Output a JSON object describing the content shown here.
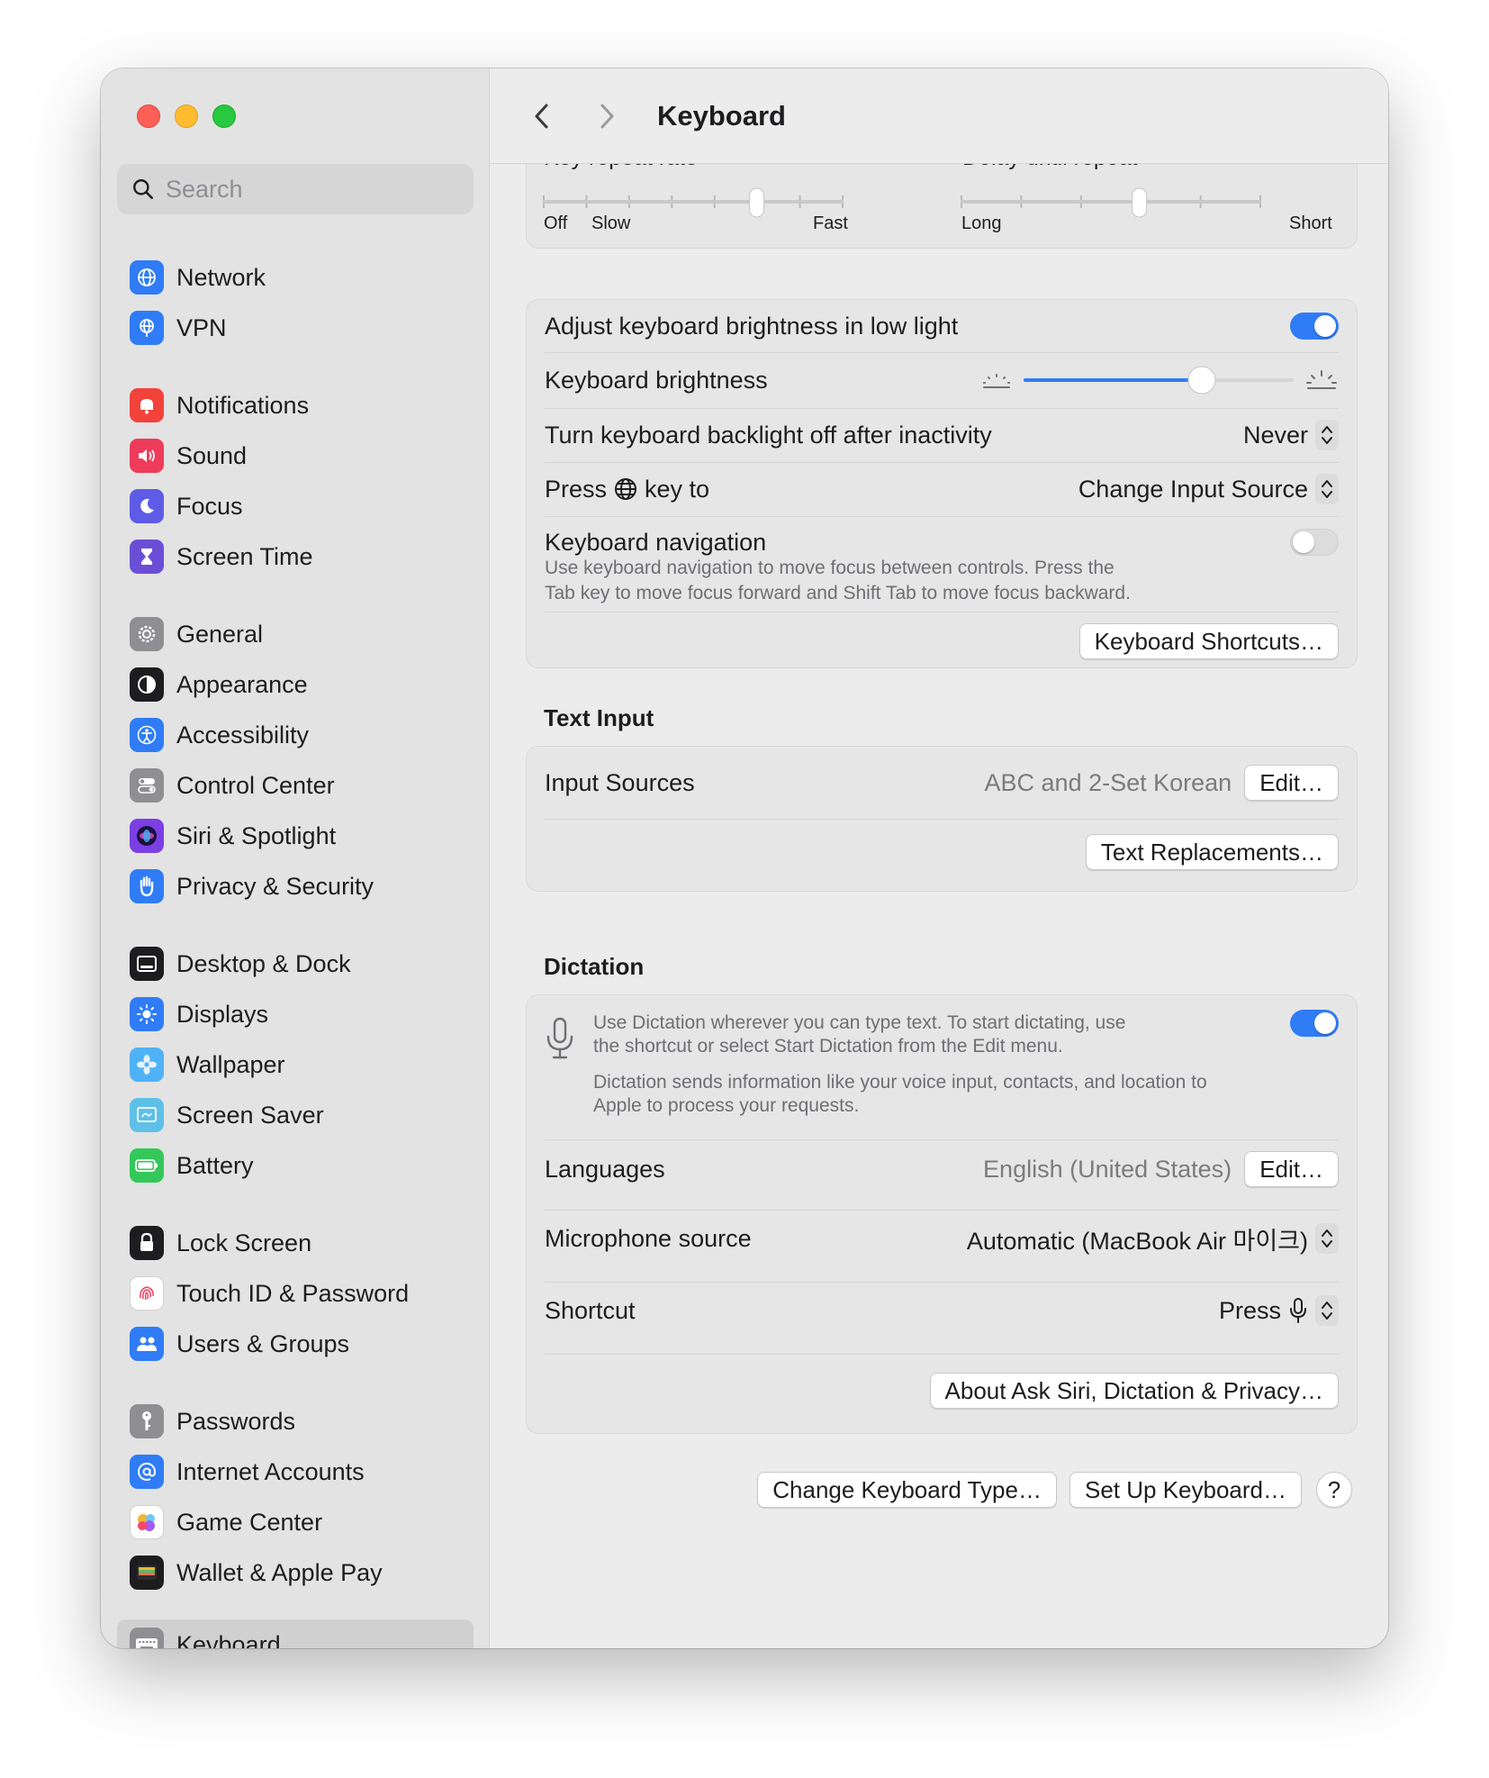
{
  "window": {
    "title": "Keyboard",
    "accent": "#2f7cf6"
  },
  "sidebar": {
    "search_placeholder": "Search",
    "items": [
      {
        "label": "Network",
        "icon": "globe-icon",
        "color": "#2f7cf6"
      },
      {
        "label": "VPN",
        "icon": "vpn-globe-icon",
        "color": "#2f7cf6"
      },
      {
        "label": "Notifications",
        "icon": "bell-icon",
        "color": "#f2433b"
      },
      {
        "label": "Sound",
        "icon": "speaker-icon",
        "color": "#ee3b5a"
      },
      {
        "label": "Focus",
        "icon": "moon-icon",
        "color": "#5e5ce6"
      },
      {
        "label": "Screen Time",
        "icon": "hourglass-icon",
        "color": "#6a4fd6"
      },
      {
        "label": "General",
        "icon": "gear-icon",
        "color": "#8e8e93"
      },
      {
        "label": "Appearance",
        "icon": "appearance-icon",
        "color": "#1d1d1f"
      },
      {
        "label": "Accessibility",
        "icon": "accessibility-icon",
        "color": "#2f7cf6"
      },
      {
        "label": "Control Center",
        "icon": "switches-icon",
        "color": "#8e8e93"
      },
      {
        "label": "Siri & Spotlight",
        "icon": "siri-icon",
        "color": "#7b3fe4"
      },
      {
        "label": "Privacy & Security",
        "icon": "hand-icon",
        "color": "#2f7cf6"
      },
      {
        "label": "Desktop & Dock",
        "icon": "dock-icon",
        "color": "#1d1d1f"
      },
      {
        "label": "Displays",
        "icon": "sun-icon",
        "color": "#2f7cf6"
      },
      {
        "label": "Wallpaper",
        "icon": "flower-icon",
        "color": "#4fb2f7"
      },
      {
        "label": "Screen Saver",
        "icon": "screen-saver-icon",
        "color": "#5ec0e8"
      },
      {
        "label": "Battery",
        "icon": "battery-icon",
        "color": "#34c759"
      },
      {
        "label": "Lock Screen",
        "icon": "lock-icon",
        "color": "#1d1d1f"
      },
      {
        "label": "Touch ID & Password",
        "icon": "fingerprint-icon",
        "color": "#ffffff"
      },
      {
        "label": "Users & Groups",
        "icon": "users-icon",
        "color": "#2f7cf6"
      },
      {
        "label": "Passwords",
        "icon": "key-icon",
        "color": "#8e8e93"
      },
      {
        "label": "Internet Accounts",
        "icon": "at-icon",
        "color": "#2f7cf6"
      },
      {
        "label": "Game Center",
        "icon": "game-center-icon",
        "color": "#ffffff"
      },
      {
        "label": "Wallet & Apple Pay",
        "icon": "wallet-icon",
        "color": "#1d1d1f"
      },
      {
        "label": "Keyboard",
        "icon": "keyboard-icon",
        "color": "#8e8e93",
        "selected": true
      }
    ]
  },
  "repeat": {
    "key_repeat_label": "Key repeat rate",
    "delay_label": "Delay until repeat",
    "repeat_off": "Off",
    "repeat_slow": "Slow",
    "repeat_fast": "Fast",
    "delay_long": "Long",
    "delay_short": "Short",
    "repeat_notch": 7,
    "delay_notch": 4
  },
  "keyboard": {
    "auto_brightness_label": "Adjust keyboard brightness in low light",
    "auto_brightness_on": true,
    "brightness_label": "Keyboard brightness",
    "brightness_level": 0.66,
    "backlight_label": "Turn keyboard backlight off after inactivity",
    "backlight_value": "Never",
    "press_label_prefix": "Press",
    "press_label_suffix": "key to",
    "press_value": "Change Input Source",
    "nav_label": "Keyboard navigation",
    "nav_on": false,
    "nav_description": "Use keyboard navigation to move focus between controls. Press the Tab key to move focus forward and Shift Tab to move focus backward.",
    "shortcuts_button": "Keyboard Shortcuts…"
  },
  "text_input": {
    "section_title": "Text Input",
    "sources_label": "Input Sources",
    "sources_value": "ABC and 2-Set Korean",
    "edit_button": "Edit…",
    "replacements_button": "Text Replacements…"
  },
  "dictation": {
    "section_title": "Dictation",
    "on": true,
    "description": "Use Dictation wherever you can type text. To start dictating, use the shortcut or select Start Dictation from the Edit menu.",
    "privacy_note": "Dictation sends information like your voice input, contacts, and location to Apple to process your requests.",
    "languages_label": "Languages",
    "languages_value": "English (United States)",
    "languages_edit": "Edit…",
    "mic_label": "Microphone source",
    "mic_value": "Automatic (MacBook Air 마이크)",
    "shortcut_label": "Shortcut",
    "shortcut_value": "Press",
    "about_button": "About Ask Siri, Dictation & Privacy…"
  },
  "footer": {
    "change_type_button": "Change Keyboard Type…",
    "setup_button": "Set Up Keyboard…",
    "help_button": "?"
  }
}
